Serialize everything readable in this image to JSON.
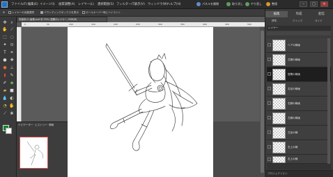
{
  "menubar": {
    "app_logo": "PSE",
    "items": [
      "ファイル(F)",
      "編集(E)",
      "イメージ(I)",
      "画質調整(A)",
      "レイヤー(L)",
      "選択範囲(S)",
      "フィルター(T)",
      "表示(V)",
      "ウィンドウ(W)",
      "ヘルプ(H)"
    ],
    "button_new": "新規",
    "button_create": "作成",
    "button_share": "パネルを開閉",
    "undo_label": "取り消し",
    "redo_label": "やり直し",
    "organizer_label": "整理"
  },
  "options_bar": {
    "items": [
      "レイヤーの自動選択",
      "バウンディングボックスを表示",
      "ロールオーバー時にハイライト"
    ]
  },
  "document": {
    "tab_title": "未保存(1) 画像.psd @ 33% (宮殿のレイヤー, RGB/8)",
    "ruler_marks": [
      "0",
      "50",
      "100",
      "150",
      "200",
      "250",
      "300",
      "350",
      "400",
      "450",
      "500"
    ]
  },
  "navigator": {
    "tabs": [
      "ナビゲーター",
      "ヒストリー",
      "情報"
    ]
  },
  "right_panel": {
    "tabs": [
      "編集",
      "作成",
      "配信"
    ],
    "sub_items": [
      "標準",
      "クイック",
      "ガイド"
    ],
    "layers_title": "レイヤー",
    "layers": [
      {
        "name": "ヘアの線画"
      },
      {
        "name": "左腕の線画"
      },
      {
        "name": "宮殿の線画",
        "active": true
      },
      {
        "name": "右足の線画"
      },
      {
        "name": "右腕の線画"
      },
      {
        "name": "左腕の線画"
      },
      {
        "name": "左足の線"
      },
      {
        "name": "右上の線"
      },
      {
        "name": "右上の線"
      }
    ],
    "bottom_label": "プロジェクトビン"
  },
  "colors": {
    "foreground": "#0f8a2a",
    "background": "#ffffff",
    "accent": "#2a6fb7"
  }
}
